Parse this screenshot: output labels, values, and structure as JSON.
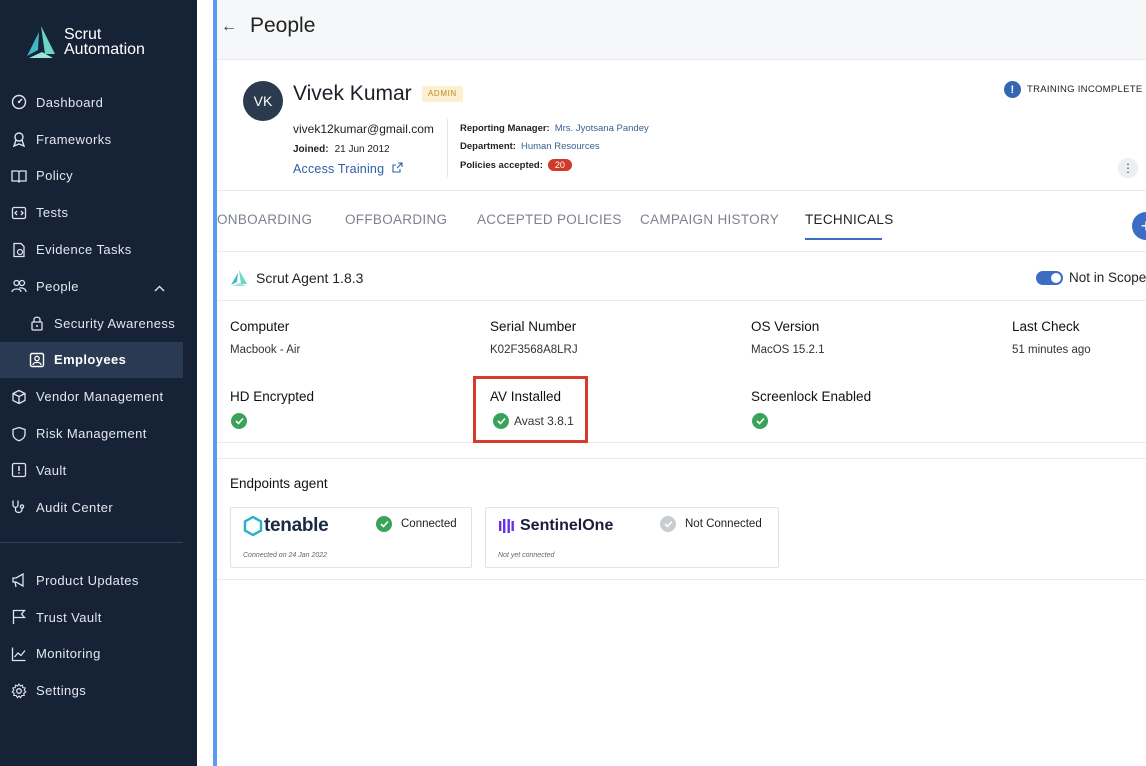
{
  "brand": {
    "line1": "Scrut",
    "line2": "Automation"
  },
  "sidebar": {
    "items": [
      {
        "label": "Dashboard",
        "icon": "dashboard-icon"
      },
      {
        "label": "Frameworks",
        "icon": "framework-icon"
      },
      {
        "label": "Policy",
        "icon": "book-icon"
      },
      {
        "label": "Tests",
        "icon": "code-icon"
      },
      {
        "label": "Evidence Tasks",
        "icon": "evidence-icon"
      },
      {
        "label": "People",
        "icon": "people-icon"
      },
      {
        "label": "Security Awareness",
        "icon": "lock-icon"
      },
      {
        "label": "Employees",
        "icon": "person-badge-icon"
      },
      {
        "label": "Vendor Management",
        "icon": "cube-icon"
      },
      {
        "label": "Risk Management",
        "icon": "shield-icon"
      },
      {
        "label": "Vault",
        "icon": "vault-icon"
      },
      {
        "label": "Audit Center",
        "icon": "stethoscope-icon"
      }
    ],
    "bottom_items": [
      {
        "label": "Product Updates",
        "icon": "megaphone-icon"
      },
      {
        "label": "Trust Vault",
        "icon": "flag-icon"
      },
      {
        "label": "Monitoring",
        "icon": "chart-line-icon"
      },
      {
        "label": "Settings",
        "icon": "gear-icon"
      }
    ]
  },
  "header": {
    "title": "People"
  },
  "profile": {
    "initials": "VK",
    "name": "Vivek Kumar",
    "role": "ADMIN",
    "email": "vivek12kumar@gmail.com",
    "joined_label": "Joined:",
    "joined_value": "21 Jun 2012",
    "access_link": "Access Training",
    "reporting_label": "Reporting Manager:",
    "reporting_value": "Mrs. Jyotsana Pandey",
    "department_label": "Department:",
    "department_value": "Human Resources",
    "policies_label": "Policies accepted:",
    "policies_value": "20",
    "training_status": "TRAINING INCOMPLETE"
  },
  "tabs": [
    "ONBOARDING",
    "OFFBOARDING",
    "ACCEPTED POLICIES",
    "CAMPAIGN HISTORY",
    "TECHNICALS"
  ],
  "agent": {
    "title": "Scrut Agent 1.8.3",
    "scope_label": "Not in Scope",
    "fields": {
      "computer_label": "Computer",
      "computer_value": "Macbook - Air",
      "serial_label": "Serial Number",
      "serial_value": "K02F3568A8LRJ",
      "os_label": "OS Version",
      "os_value": "MacOS 15.2.1",
      "lastcheck_label": "Last Check",
      "lastcheck_value": "51 minutes ago",
      "hd_label": "HD Encrypted",
      "av_label": "AV Installed",
      "av_value": "Avast 3.8.1",
      "screenlock_label": "Screenlock Enabled"
    }
  },
  "endpoints": {
    "title": "Endpoints agent",
    "cards": [
      {
        "logo": "tenable",
        "status": "Connected",
        "note": "Connected on 24 Jan 2022"
      },
      {
        "logo": "SentinelOne",
        "status": "Not Connected",
        "note": "Not yet connected"
      }
    ]
  },
  "colors": {
    "sidebar_bg": "#162236",
    "accent": "#3b6dc4",
    "success": "#3aa35a",
    "danger": "#cf3a2a"
  }
}
